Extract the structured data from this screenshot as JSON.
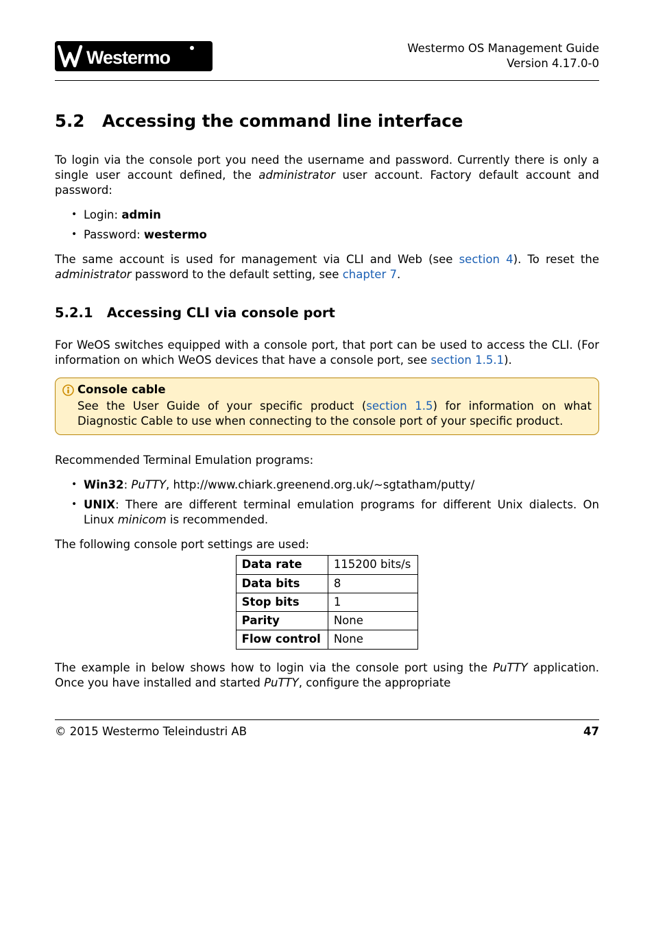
{
  "header": {
    "doc_title": "Westermo OS Management Guide",
    "version": "Version 4.17.0-0",
    "logo_text": "Westermo"
  },
  "section": {
    "number": "5.2",
    "title": "Accessing the command line interface"
  },
  "para1a": "To login via the console port you need the username and password. Currently there is only a single user account defined, the ",
  "para1b": "administrator",
  "para1c": " user account. Factory default account and password:",
  "login_label": "Login: ",
  "login_value": "admin",
  "password_label": "Password: ",
  "password_value": "westermo",
  "para2a": "The same account is used for management via CLI and Web (see ",
  "para2b": "section 4",
  "para2c": "). To reset the ",
  "para2d": "administrator",
  "para2e": " password to the default setting, see ",
  "para2f": "chapter 7",
  "para2g": ".",
  "subsection": {
    "number": "5.2.1",
    "title": "Accessing CLI via console port"
  },
  "para3a": "For WeOS switches equipped with a console port, that port can be used to access the CLI. (For information on which WeOS devices that have a console port, see ",
  "para3b": "section 1.5.1",
  "para3c": ").",
  "callout": {
    "title": "Console cable",
    "body_a": "See the User Guide of your specific product (",
    "body_b": "section 1.5",
    "body_c": ") for information on what Diagnostic Cable to use when connecting to the console port of your specific product."
  },
  "para4": "Recommended Terminal Emulation programs:",
  "bullet_win_a": "Win32",
  "bullet_win_b": ": ",
  "bullet_win_c": "PuTTY",
  "bullet_win_d": ", http://www.chiark.greenend.org.uk/~sgtatham/putty/",
  "bullet_unix_a": "UNIX",
  "bullet_unix_b": ": There are different terminal emulation programs for different Unix dialects. On Linux ",
  "bullet_unix_c": "minicom",
  "bullet_unix_d": " is recommended.",
  "para5": "The following console port settings are used:",
  "table": {
    "r1k": "Data rate",
    "r1v": "115200 bits/s",
    "r2k": "Data bits",
    "r2v": "8",
    "r3k": "Stop bits",
    "r3v": "1",
    "r4k": "Parity",
    "r4v": "None",
    "r5k": "Flow control",
    "r5v": "None"
  },
  "para6a": "The example in below shows how to login via the console port using the ",
  "para6b": "PuTTY",
  "para6c": " application. Once you have installed and started ",
  "para6d": "PuTTY",
  "para6e": ", configure the appropriate",
  "footer": {
    "copyright": "© 2015 Westermo Teleindustri AB",
    "page": "47"
  }
}
